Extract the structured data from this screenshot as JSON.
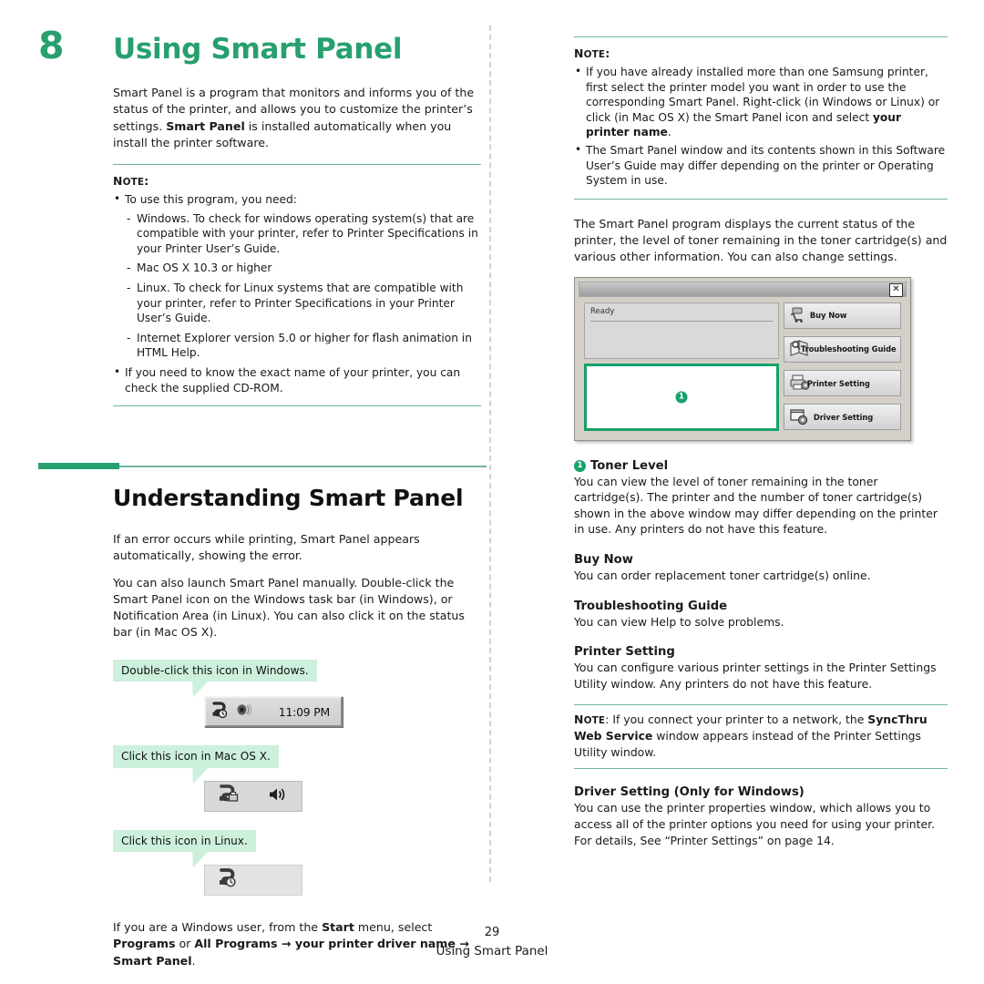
{
  "chapter": {
    "number": "8",
    "title": "Using Smart Panel"
  },
  "intro": {
    "text_1": "Smart Panel is a program that monitors and informs you of the status of the printer, and allows you to customize the printer’s settings. ",
    "bold_1": "Smart Panel",
    "text_2": " is installed automatically when you install the printer software."
  },
  "note_label": "N",
  "note_label_rest": "OTE",
  "note_colon": ":",
  "left_note": {
    "bullet_1": "To use this program, you need:",
    "sub_1": "Windows. To check for windows operating system(s) that are compatible with your printer, refer to Printer Specifications in your Printer User’s Guide.",
    "sub_2": "Mac OS X 10.3 or higher",
    "sub_3": "Linux. To check for Linux systems that are compatible with your printer, refer to Printer Specifications in your Printer User’s Guide.",
    "sub_4": "Internet Explorer version 5.0 or higher for flash animation in HTML Help.",
    "bullet_2": "If you need to know the exact name of your printer, you can check the supplied CD-ROM."
  },
  "section": {
    "title": "Understanding Smart Panel",
    "para_1": "If an error occurs while printing, Smart Panel appears automatically, showing the error.",
    "para_2": "You can also launch Smart Panel manually. Double-click the Smart Panel icon on the Windows task bar (in Windows), or Notification Area (in Linux). You can also click it on the status bar (in Mac OS X)."
  },
  "callouts": {
    "windows": "Double-click this icon in Windows.",
    "mac": "Click this icon in Mac OS X.",
    "linux": "Click this icon in Linux."
  },
  "taskbar": {
    "clock": "11:09 PM",
    "smart_panel_icon": "smart-panel-tray-icon",
    "speaker_icon": "speaker-icon"
  },
  "start_menu": {
    "lead": "If you are a Windows user, from the ",
    "start": "Start",
    "mid": " menu, select ",
    "programs": "Programs",
    "or": " or ",
    "all_programs": "All Programs",
    "arrow_1": " → ",
    "driver_name": "your printer driver name",
    "arrow_2": " → ",
    "smart_panel": "Smart Panel",
    "period": "."
  },
  "right_note": {
    "bullet_1_a": "If you have already installed more than one Samsung printer, first select the printer model you want in order to use the corresponding Smart Panel. Right-click (in Windows or Linux) or click (in Mac OS X) the Smart Panel icon and select ",
    "bullet_1_b": "your printer name",
    "bullet_1_c": ".",
    "bullet_2": "The Smart Panel window and its contents shown in this Software User’s Guide may differ depending on the printer or Operating System in use."
  },
  "right_intro": "The Smart Panel program displays the current status of the printer, the level of toner remaining in the toner cartridge(s) and various other information. You can also change settings.",
  "smart_panel_window": {
    "close_label": "✕",
    "status_text": "Ready",
    "toner_badge": "1",
    "buttons": [
      {
        "label": "Buy Now",
        "icon": "shopping-cart-printer-icon"
      },
      {
        "label": "Troubleshooting Guide",
        "icon": "book-magnifier-icon"
      },
      {
        "label": "Printer Setting",
        "icon": "printer-gear-icon"
      },
      {
        "label": "Driver Setting",
        "icon": "window-gear-icon"
      }
    ]
  },
  "features": [
    {
      "badge": "1",
      "heading": "Toner Level",
      "body": "You can view the level of toner remaining in the toner cartridge(s). The printer and the number of toner cartridge(s) shown in the above window may differ depending on the printer in use. Any printers do not have this feature."
    },
    {
      "badge": "",
      "heading": "Buy Now",
      "body": "You can order replacement toner cartridge(s) online."
    },
    {
      "badge": "",
      "heading": "Troubleshooting Guide",
      "body": "You can view Help to solve problems."
    },
    {
      "badge": "",
      "heading": "Printer Setting",
      "body": "You can configure various printer settings in the Printer Settings Utility window. Any printers do not have this feature."
    }
  ],
  "syncthru_note": {
    "lead": ": If you connect your printer to a network, the ",
    "bold": "SyncThru Web Service",
    "tail": " window appears instead of the Printer Settings Utility window."
  },
  "driver_setting": {
    "heading": "Driver Setting (Only for Windows)",
    "body": "You can use the printer properties window, which allows you to access all of the printer options you need for using your printer. For details, See “Printer Settings” on page 14."
  },
  "footer": {
    "page_number": "29",
    "title": "Using Smart Panel"
  },
  "colors": {
    "accent_green": "#27a06e",
    "rule_teal": "#6fb3a4",
    "callout_bg": "#ccf0dc",
    "badge_green": "#16a06a"
  }
}
